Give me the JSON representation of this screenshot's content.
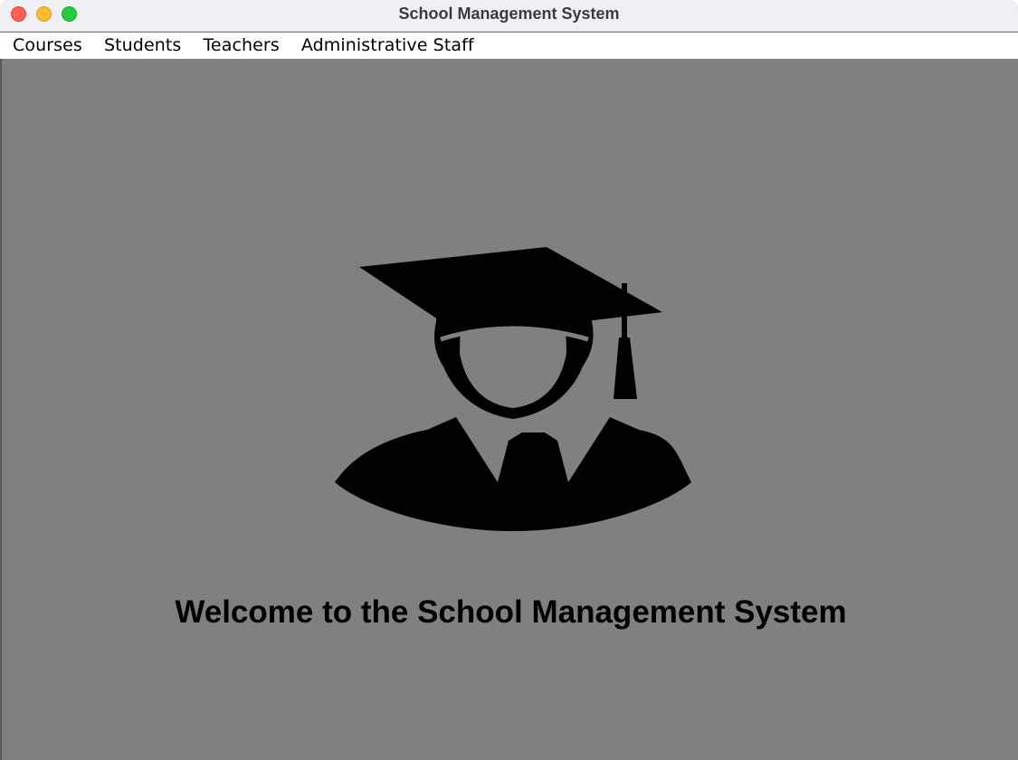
{
  "window": {
    "title": "School Management System"
  },
  "menubar": {
    "items": [
      {
        "label": "Courses"
      },
      {
        "label": "Students"
      },
      {
        "label": "Teachers"
      },
      {
        "label": "Administrative Staff"
      }
    ]
  },
  "main": {
    "image_icon": "graduate-icon",
    "welcome_text": "Welcome to the School Management System"
  },
  "colors": {
    "background": "#808080",
    "text": "#000000",
    "close": "#fe5f57",
    "minimize": "#febc2e",
    "zoom": "#28c840"
  }
}
